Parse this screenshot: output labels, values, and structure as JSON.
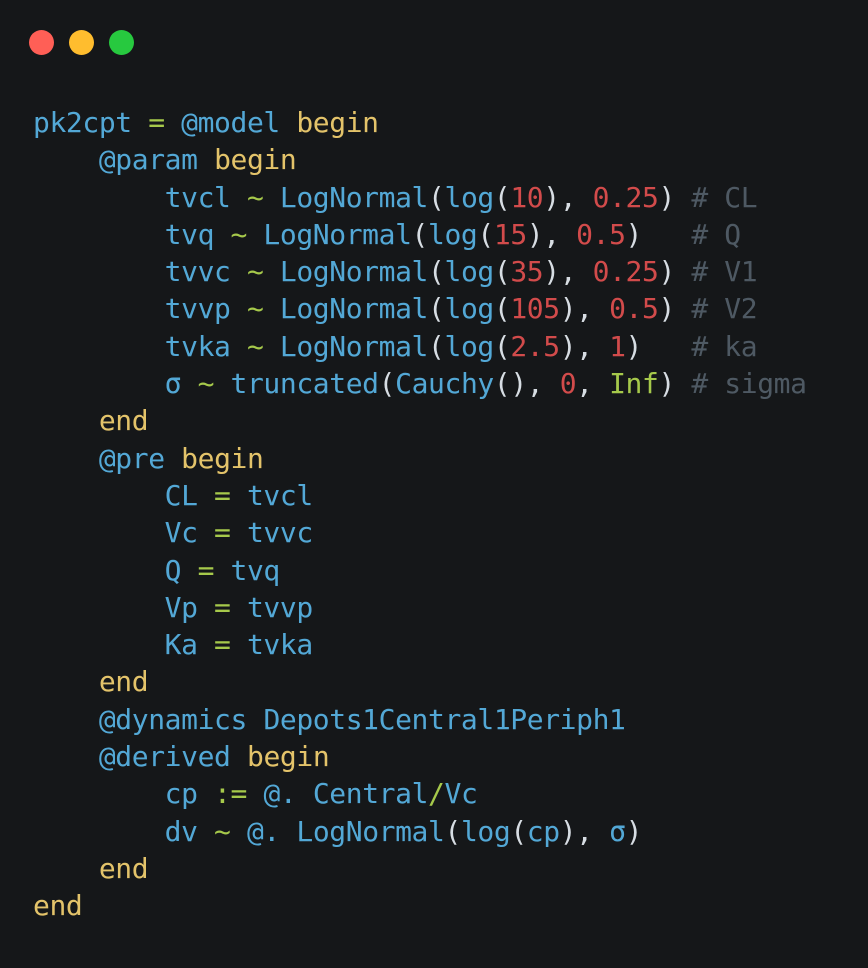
{
  "window": {
    "controls": [
      {
        "name": "close",
        "color": "#ff5f56"
      },
      {
        "name": "minimize",
        "color": "#ffbd2e"
      },
      {
        "name": "maximize",
        "color": "#27c93f"
      }
    ]
  },
  "colors": {
    "ident": "#53a8d6",
    "keyword": "#e3c36a",
    "op": "#a6c94b",
    "num": "#d24b4b",
    "punct": "#d7dde3",
    "comment": "#4e5963",
    "plain": "#d7dde3"
  },
  "code": [
    [
      [
        "pk2cpt",
        "ident"
      ],
      [
        " = ",
        "op"
      ],
      [
        "@model",
        "ident"
      ],
      [
        " ",
        "plain"
      ],
      [
        "begin",
        "keyword"
      ]
    ],
    [
      [
        "    ",
        "plain"
      ],
      [
        "@param",
        "ident"
      ],
      [
        " ",
        "plain"
      ],
      [
        "begin",
        "keyword"
      ]
    ],
    [
      [
        "        ",
        "plain"
      ],
      [
        "tvcl",
        "ident"
      ],
      [
        " ~ ",
        "op"
      ],
      [
        "LogNormal",
        "ident"
      ],
      [
        "(",
        "punct"
      ],
      [
        "log",
        "ident"
      ],
      [
        "(",
        "punct"
      ],
      [
        "10",
        "num"
      ],
      [
        "), ",
        "punct"
      ],
      [
        "0.25",
        "num"
      ],
      [
        ")",
        "punct"
      ],
      [
        " # CL",
        "comment"
      ]
    ],
    [
      [
        "        ",
        "plain"
      ],
      [
        "tvq",
        "ident"
      ],
      [
        " ~ ",
        "op"
      ],
      [
        "LogNormal",
        "ident"
      ],
      [
        "(",
        "punct"
      ],
      [
        "log",
        "ident"
      ],
      [
        "(",
        "punct"
      ],
      [
        "15",
        "num"
      ],
      [
        "), ",
        "punct"
      ],
      [
        "0.5",
        "num"
      ],
      [
        ")",
        "punct"
      ],
      [
        "   # Q",
        "comment"
      ]
    ],
    [
      [
        "        ",
        "plain"
      ],
      [
        "tvvc",
        "ident"
      ],
      [
        " ~ ",
        "op"
      ],
      [
        "LogNormal",
        "ident"
      ],
      [
        "(",
        "punct"
      ],
      [
        "log",
        "ident"
      ],
      [
        "(",
        "punct"
      ],
      [
        "35",
        "num"
      ],
      [
        "), ",
        "punct"
      ],
      [
        "0.25",
        "num"
      ],
      [
        ")",
        "punct"
      ],
      [
        " # V1",
        "comment"
      ]
    ],
    [
      [
        "        ",
        "plain"
      ],
      [
        "tvvp",
        "ident"
      ],
      [
        " ~ ",
        "op"
      ],
      [
        "LogNormal",
        "ident"
      ],
      [
        "(",
        "punct"
      ],
      [
        "log",
        "ident"
      ],
      [
        "(",
        "punct"
      ],
      [
        "105",
        "num"
      ],
      [
        "), ",
        "punct"
      ],
      [
        "0.5",
        "num"
      ],
      [
        ")",
        "punct"
      ],
      [
        " # V2",
        "comment"
      ]
    ],
    [
      [
        "        ",
        "plain"
      ],
      [
        "tvka",
        "ident"
      ],
      [
        " ~ ",
        "op"
      ],
      [
        "LogNormal",
        "ident"
      ],
      [
        "(",
        "punct"
      ],
      [
        "log",
        "ident"
      ],
      [
        "(",
        "punct"
      ],
      [
        "2.5",
        "num"
      ],
      [
        "), ",
        "punct"
      ],
      [
        "1",
        "num"
      ],
      [
        ")",
        "punct"
      ],
      [
        "   # ka",
        "comment"
      ]
    ],
    [
      [
        "        ",
        "plain"
      ],
      [
        "σ",
        "ident"
      ],
      [
        " ~ ",
        "op"
      ],
      [
        "truncated",
        "ident"
      ],
      [
        "(",
        "punct"
      ],
      [
        "Cauchy",
        "ident"
      ],
      [
        "(), ",
        "punct"
      ],
      [
        "0",
        "num"
      ],
      [
        ", ",
        "punct"
      ],
      [
        "Inf",
        "op"
      ],
      [
        ")",
        "punct"
      ],
      [
        " # sigma",
        "comment"
      ]
    ],
    [
      [
        "    ",
        "plain"
      ],
      [
        "end",
        "keyword"
      ]
    ],
    [
      [
        "    ",
        "plain"
      ],
      [
        "@pre",
        "ident"
      ],
      [
        " ",
        "plain"
      ],
      [
        "begin",
        "keyword"
      ]
    ],
    [
      [
        "        ",
        "plain"
      ],
      [
        "CL",
        "ident"
      ],
      [
        " = ",
        "op"
      ],
      [
        "tvcl",
        "ident"
      ]
    ],
    [
      [
        "        ",
        "plain"
      ],
      [
        "Vc",
        "ident"
      ],
      [
        " = ",
        "op"
      ],
      [
        "tvvc",
        "ident"
      ]
    ],
    [
      [
        "        ",
        "plain"
      ],
      [
        "Q",
        "ident"
      ],
      [
        " = ",
        "op"
      ],
      [
        "tvq",
        "ident"
      ]
    ],
    [
      [
        "        ",
        "plain"
      ],
      [
        "Vp",
        "ident"
      ],
      [
        " = ",
        "op"
      ],
      [
        "tvvp",
        "ident"
      ]
    ],
    [
      [
        "        ",
        "plain"
      ],
      [
        "Ka",
        "ident"
      ],
      [
        " = ",
        "op"
      ],
      [
        "tvka",
        "ident"
      ]
    ],
    [
      [
        "    ",
        "plain"
      ],
      [
        "end",
        "keyword"
      ]
    ],
    [
      [
        "    ",
        "plain"
      ],
      [
        "@dynamics",
        "ident"
      ],
      [
        " ",
        "plain"
      ],
      [
        "Depots1Central1Periph1",
        "ident"
      ]
    ],
    [
      [
        "    ",
        "plain"
      ],
      [
        "@derived",
        "ident"
      ],
      [
        " ",
        "plain"
      ],
      [
        "begin",
        "keyword"
      ]
    ],
    [
      [
        "        ",
        "plain"
      ],
      [
        "cp",
        "ident"
      ],
      [
        " := ",
        "op"
      ],
      [
        "@.",
        "ident"
      ],
      [
        " ",
        "plain"
      ],
      [
        "Central",
        "ident"
      ],
      [
        "/",
        "op"
      ],
      [
        "Vc",
        "ident"
      ]
    ],
    [
      [
        "        ",
        "plain"
      ],
      [
        "dv",
        "ident"
      ],
      [
        " ~ ",
        "op"
      ],
      [
        "@.",
        "ident"
      ],
      [
        " ",
        "plain"
      ],
      [
        "LogNormal",
        "ident"
      ],
      [
        "(",
        "punct"
      ],
      [
        "log",
        "ident"
      ],
      [
        "(",
        "punct"
      ],
      [
        "cp",
        "ident"
      ],
      [
        "), ",
        "punct"
      ],
      [
        "σ",
        "ident"
      ],
      [
        ")",
        "punct"
      ]
    ],
    [
      [
        "    ",
        "plain"
      ],
      [
        "end",
        "keyword"
      ]
    ],
    [
      [
        "end",
        "keyword"
      ]
    ]
  ]
}
